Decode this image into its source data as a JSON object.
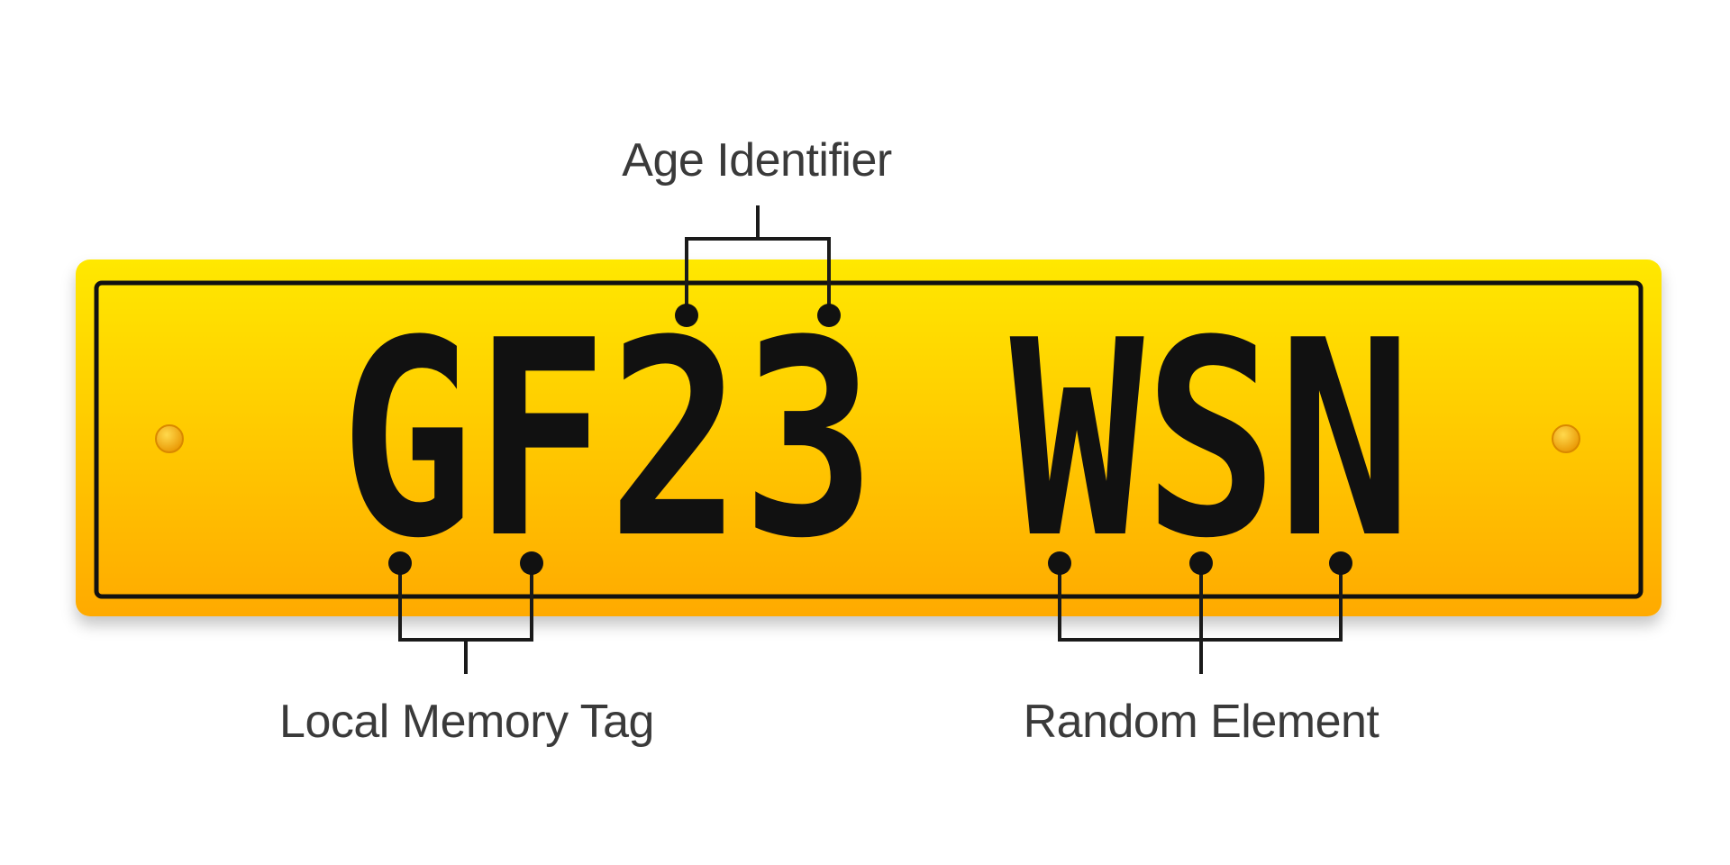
{
  "plate": {
    "registration": "GF23 WSN",
    "background_color_top": "#FFE800",
    "background_color_bottom": "#FFAA00",
    "border_color": "#111111",
    "text_color": "#111111"
  },
  "annotations": {
    "age_identifier": "Age Identifier",
    "local_memory_tag": "Local Memory Tag",
    "random_element": "Random Element"
  }
}
